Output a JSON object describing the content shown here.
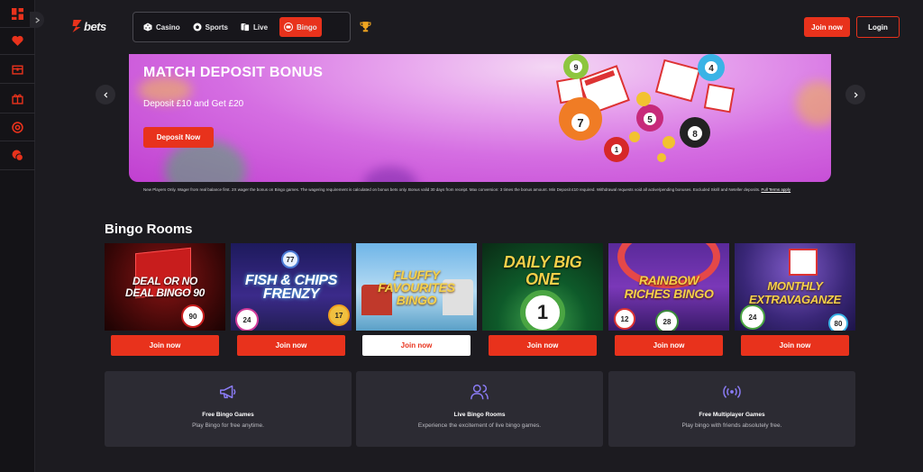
{
  "brand": {
    "logo_text": "bets",
    "accent": "#e8321c"
  },
  "sidebar": {
    "items": [
      {
        "icon": "dashboard-icon"
      },
      {
        "icon": "heart-icon"
      },
      {
        "icon": "treasure-chest-icon"
      },
      {
        "icon": "gift-icon"
      },
      {
        "icon": "lifebuoy-icon"
      },
      {
        "icon": "chat-support-icon"
      }
    ]
  },
  "nav": {
    "items": [
      {
        "label": "Casino",
        "icon": "dice-icon"
      },
      {
        "label": "Sports",
        "icon": "football-icon"
      },
      {
        "label": "Live",
        "icon": "cards-icon"
      },
      {
        "label": "Bingo",
        "icon": "bingo-ball-icon",
        "active": true
      }
    ]
  },
  "header": {
    "join_label": "Join now",
    "login_label": "Login"
  },
  "banner": {
    "title": "MATCH DEPOSIT BONUS",
    "subtitle": "Deposit £10 and Get £20",
    "cta_label": "Deposit Now"
  },
  "terms": {
    "text": "New Players Only. Wager from real balance first. 2X wager the bonus on Bingo games. The wagering requirement is calculated on bonus bets only. Bonus valid 30 days from receipt. Max conversion: 3 times the bonus amount. Min Deposit £10 required. Withdrawal requests void all active/pending bonuses. Excluded Skrill and Neteller deposits.",
    "link_label": "Full Terms apply"
  },
  "rooms": {
    "title": "Bingo Rooms",
    "items": [
      {
        "name": "DEAL OR NO DEAL BINGO 90",
        "button": "Join now"
      },
      {
        "name": "FISH & CHIPS FRENZY",
        "button": "Join now"
      },
      {
        "name": "FLUFFY FAVOURITES BINGO",
        "button": "Join now"
      },
      {
        "name": "DAILY BIG ONE",
        "button": "Join now"
      },
      {
        "name": "RAINBOW RICHES BINGO",
        "button": "Join now"
      },
      {
        "name": "MONTHLY EXTRAVAGANZE",
        "button": "Join now"
      }
    ]
  },
  "features": [
    {
      "title": "Free Bingo Games",
      "description": "Play Bingo for free anytime.",
      "icon": "megaphone-icon"
    },
    {
      "title": "Live Bingo Rooms",
      "description": "Experience the excitement of live bingo games.",
      "icon": "users-icon"
    },
    {
      "title": "Free Multiplayer Games",
      "description": "Play bingo with friends absolutely free.",
      "icon": "broadcast-icon"
    }
  ]
}
